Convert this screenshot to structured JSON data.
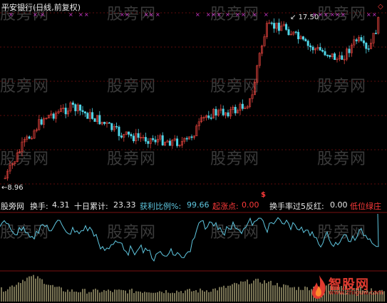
{
  "header": {
    "title": "平安银行(日线,前复权)",
    "price_high_label": "17.50",
    "price_low_label": "8.96"
  },
  "indicators": {
    "brand": "股旁网",
    "turnover_label": "换手:",
    "turnover_value": "4.31",
    "ten_day_label": "十日累计:",
    "ten_day_value": "23.33",
    "profit_ratio_label": "获利比例%:",
    "profit_ratio_value": "99.66",
    "start_point_label": "起涨点:",
    "start_point_value": "0.00",
    "turnover_over5_label": "换手率过5反红:",
    "turnover_over5_value": "0.00",
    "low_position_label": "低位绿庄"
  },
  "watermarks": [
    "股旁网",
    "股旁网",
    "股旁网",
    "股旁网",
    "股旁网",
    "股旁网",
    "股旁网",
    "股旁网",
    "股旁网",
    "股旁网",
    "股旁网",
    "股旁网",
    "股旁网",
    "股旁网",
    "股旁网",
    "股旁网"
  ],
  "logo": {
    "name": "智股网",
    "url": "www.zhiguw.com"
  },
  "colors": {
    "up_candle": "#e0423c",
    "down_candle": "#4fd6e8",
    "profit_line": "#5fc7e0",
    "volume_bars": "#f0e6a8",
    "marker": "#d13bd1",
    "grid": "#7a1010",
    "accent_red": "#ff3a3a"
  }
}
